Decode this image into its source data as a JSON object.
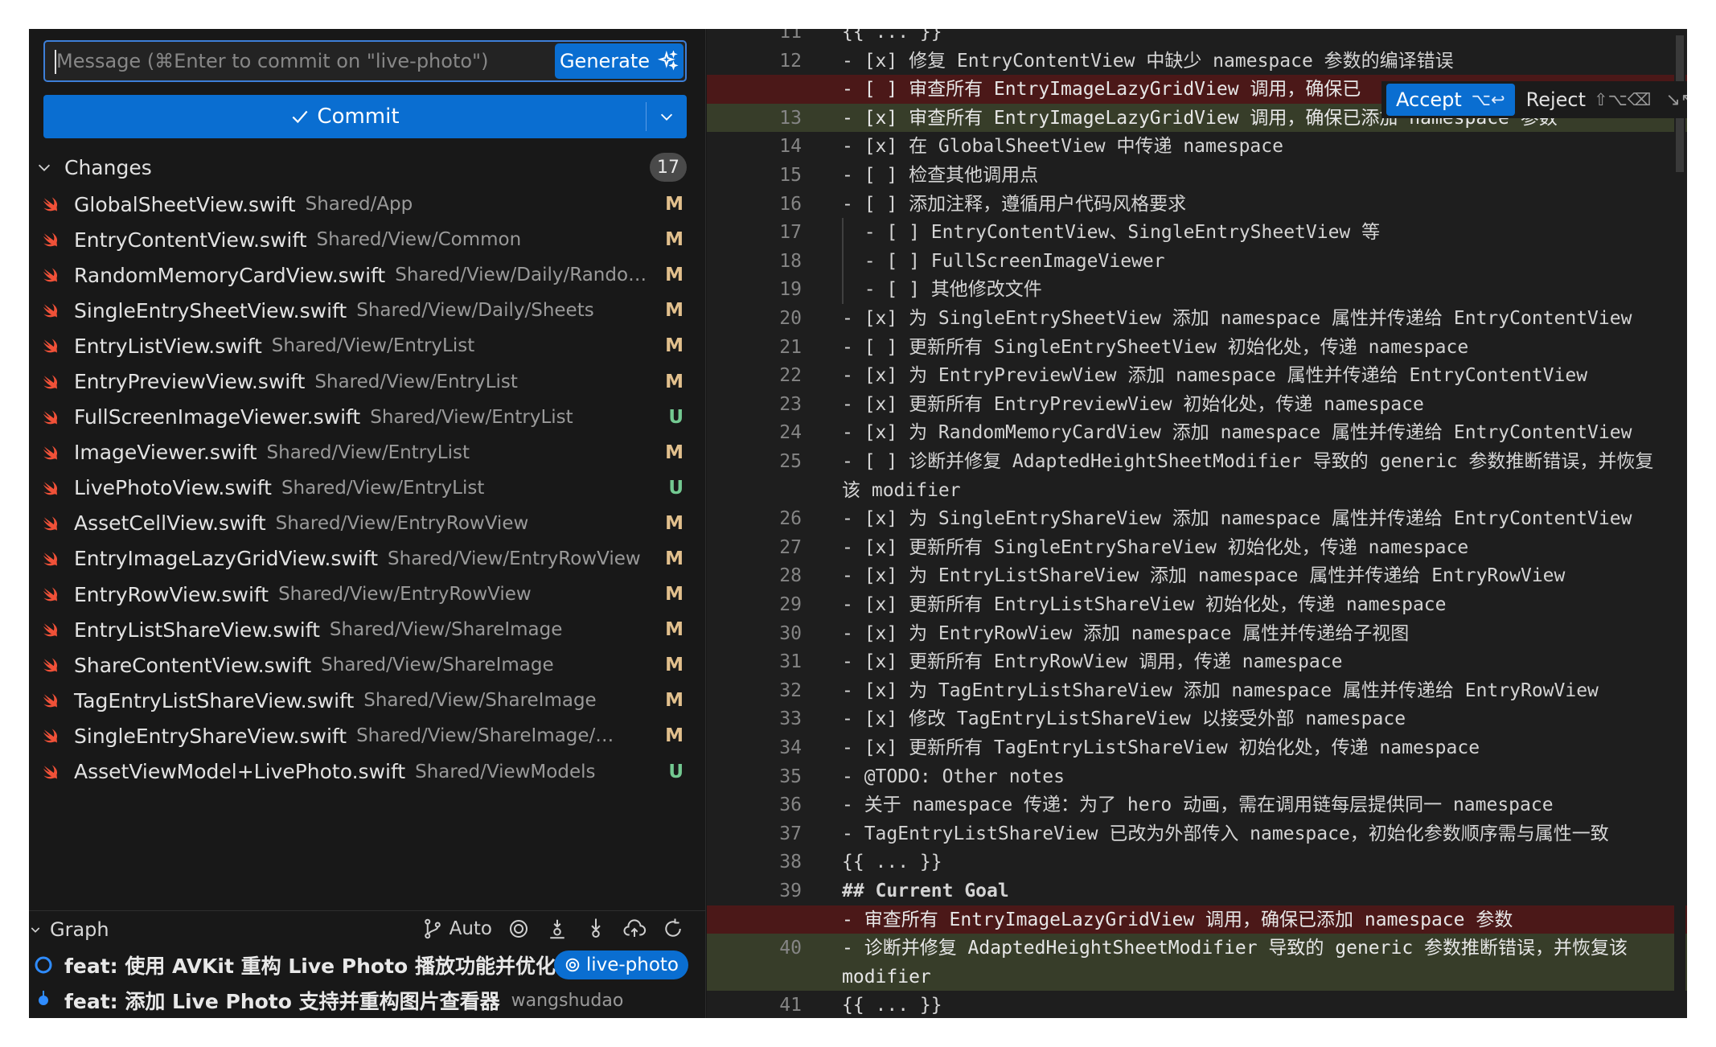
{
  "commit": {
    "placeholder": "Message (⌘Enter to commit on \"live-photo\")",
    "generate_label": "Generate",
    "commit_label": "Commit"
  },
  "changes": {
    "title": "Changes",
    "count": "17",
    "files": [
      {
        "name": "GlobalSheetView.swift",
        "path": "Shared/App",
        "status": "M"
      },
      {
        "name": "EntryContentView.swift",
        "path": "Shared/View/Common",
        "status": "M"
      },
      {
        "name": "RandomMemoryCardView.swift",
        "path": "Shared/View/Daily/Random...",
        "status": "M"
      },
      {
        "name": "SingleEntrySheetView.swift",
        "path": "Shared/View/Daily/Sheets",
        "status": "M"
      },
      {
        "name": "EntryListView.swift",
        "path": "Shared/View/EntryList",
        "status": "M"
      },
      {
        "name": "EntryPreviewView.swift",
        "path": "Shared/View/EntryList",
        "status": "M"
      },
      {
        "name": "FullScreenImageViewer.swift",
        "path": "Shared/View/EntryList",
        "status": "U"
      },
      {
        "name": "ImageViewer.swift",
        "path": "Shared/View/EntryList",
        "status": "M"
      },
      {
        "name": "LivePhotoView.swift",
        "path": "Shared/View/EntryList",
        "status": "U"
      },
      {
        "name": "AssetCellView.swift",
        "path": "Shared/View/EntryRowView",
        "status": "M"
      },
      {
        "name": "EntryImageLazyGridView.swift",
        "path": "Shared/View/EntryRowView",
        "status": "M"
      },
      {
        "name": "EntryRowView.swift",
        "path": "Shared/View/EntryRowView",
        "status": "M"
      },
      {
        "name": "EntryListShareView.swift",
        "path": "Shared/View/ShareImage",
        "status": "M"
      },
      {
        "name": "ShareContentView.swift",
        "path": "Shared/View/ShareImage",
        "status": "M"
      },
      {
        "name": "TagEntryListShareView.swift",
        "path": "Shared/View/ShareImage",
        "status": "M"
      },
      {
        "name": "SingleEntryShareView.swift",
        "path": "Shared/View/ShareImage/Single",
        "status": "M"
      },
      {
        "name": "AssetViewModel+LivePhoto.swift",
        "path": "Shared/ViewModels",
        "status": "U"
      }
    ]
  },
  "graph": {
    "title": "Graph",
    "auto_label": "Auto",
    "commits": [
      {
        "message": "feat: 使用 AVKit 重构 Live Photo 播放功能并优化...",
        "branch": "live-photo"
      },
      {
        "message": "feat: 添加 Live Photo 支持并重构图片查看器",
        "author": "wangshudao"
      }
    ]
  },
  "inline_diff": {
    "accept_label": "Accept",
    "accept_keys": "⌥↩",
    "reject_label": "Reject",
    "reject_keys": "⇧⌥⌫",
    "collapse_icon": "↘↖"
  },
  "editor_lines": [
    {
      "n": "11",
      "text": "{{ ... }}",
      "kind": "normal"
    },
    {
      "n": "12",
      "text": "- [x] 修复 EntryContentView 中缺少 namespace 参数的编译错误",
      "kind": "normal"
    },
    {
      "n": "",
      "text": "- [ ] 审查所有 EntryImageLazyGridView 调用，确保已",
      "kind": "del"
    },
    {
      "n": "13",
      "text": "- [x] 审查所有 EntryImageLazyGridView 调用，确保已添加 namespace 参数",
      "kind": "add"
    },
    {
      "n": "14",
      "text": "- [x] 在 GlobalSheetView 中传递 namespace",
      "kind": "normal"
    },
    {
      "n": "15",
      "text": "- [ ] 检查其他调用点",
      "kind": "normal"
    },
    {
      "n": "16",
      "text": "- [ ] 添加注释，遵循用户代码风格要求",
      "kind": "normal"
    },
    {
      "n": "17",
      "text": "  - [ ] EntryContentView、SingleEntrySheetView 等",
      "kind": "normal"
    },
    {
      "n": "18",
      "text": "  - [ ] FullScreenImageViewer",
      "kind": "normal"
    },
    {
      "n": "19",
      "text": "  - [ ] 其他修改文件",
      "kind": "normal"
    },
    {
      "n": "20",
      "text": "- [x] 为 SingleEntrySheetView 添加 namespace 属性并传递给 EntryContentView",
      "kind": "normal"
    },
    {
      "n": "21",
      "text": "- [ ] 更新所有 SingleEntrySheetView 初始化处，传递 namespace",
      "kind": "normal"
    },
    {
      "n": "22",
      "text": "- [x] 为 EntryPreviewView 添加 namespace 属性并传递给 EntryContentView",
      "kind": "normal"
    },
    {
      "n": "23",
      "text": "- [x] 更新所有 EntryPreviewView 初始化处，传递 namespace",
      "kind": "normal"
    },
    {
      "n": "24",
      "text": "- [x] 为 RandomMemoryCardView 添加 namespace 属性并传递给 EntryContentView",
      "kind": "normal"
    },
    {
      "n": "25",
      "text": "- [ ] 诊断并修复 AdaptedHeightSheetModifier 导致的 generic 参数推断错误，并恢复该 modifier",
      "kind": "normal",
      "wrap": true
    },
    {
      "n": "26",
      "text": "- [x] 为 SingleEntryShareView 添加 namespace 属性并传递给 EntryContentView",
      "kind": "normal"
    },
    {
      "n": "27",
      "text": "- [x] 更新所有 SingleEntryShareView 初始化处，传递 namespace",
      "kind": "normal"
    },
    {
      "n": "28",
      "text": "- [x] 为 EntryListShareView 添加 namespace 属性并传递给 EntryRowView",
      "kind": "normal"
    },
    {
      "n": "29",
      "text": "- [x] 更新所有 EntryListShareView 初始化处，传递 namespace",
      "kind": "normal"
    },
    {
      "n": "30",
      "text": "- [x] 为 EntryRowView 添加 namespace 属性并传递给子视图",
      "kind": "normal"
    },
    {
      "n": "31",
      "text": "- [x] 更新所有 EntryRowView 调用，传递 namespace",
      "kind": "normal"
    },
    {
      "n": "32",
      "text": "- [x] 为 TagEntryListShareView 添加 namespace 属性并传递给 EntryRowView",
      "kind": "normal"
    },
    {
      "n": "33",
      "text": "- [x] 修改 TagEntryListShareView 以接受外部 namespace",
      "kind": "normal"
    },
    {
      "n": "34",
      "text": "- [x] 更新所有 TagEntryListShareView 初始化处，传递 namespace",
      "kind": "normal"
    },
    {
      "n": "35",
      "text": "- @TODO: Other notes",
      "kind": "normal"
    },
    {
      "n": "36",
      "text": "- 关于 namespace 传递：为了 hero 动画，需在调用链每层提供同一 namespace",
      "kind": "normal"
    },
    {
      "n": "37",
      "text": "- TagEntryListShareView 已改为外部传入 namespace，初始化参数顺序需与属性一致",
      "kind": "normal"
    },
    {
      "n": "38",
      "text": "{{ ... }}",
      "kind": "normal"
    },
    {
      "n": "39",
      "text": "## Current Goal",
      "kind": "heading"
    },
    {
      "n": "",
      "text": "- 审查所有 EntryImageLazyGridView 调用，确保已添加 namespace 参数",
      "kind": "del"
    },
    {
      "n": "40",
      "text": "- 诊断并修复 AdaptedHeightSheetModifier 导致的 generic 参数推断错误，并恢复该 modifier",
      "kind": "add",
      "wrap": true
    },
    {
      "n": "41",
      "text": "{{ ... }}",
      "kind": "normal"
    }
  ]
}
